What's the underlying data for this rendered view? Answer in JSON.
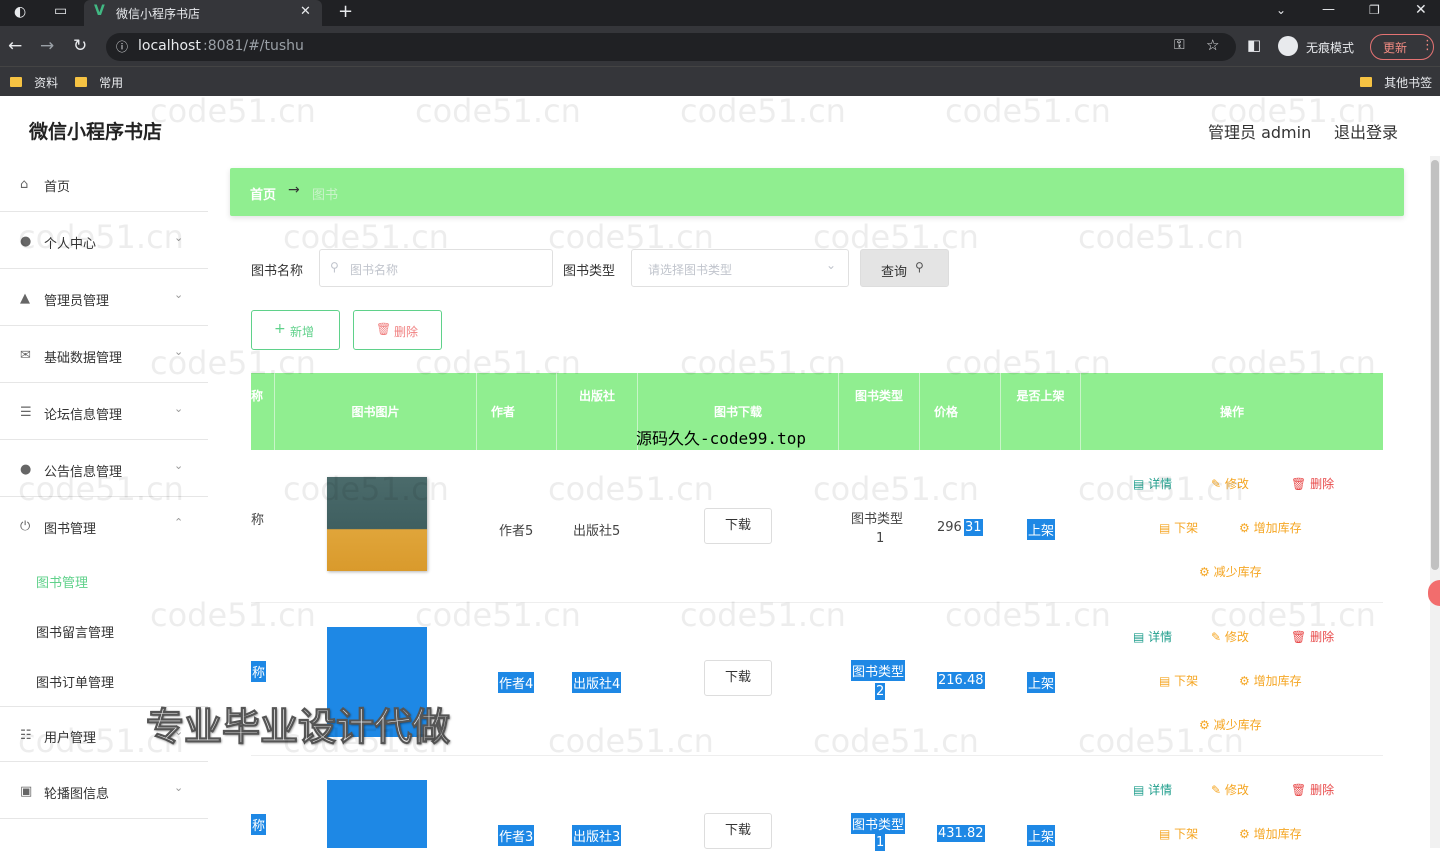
{
  "browser": {
    "tab_title": "微信小程序书店",
    "url_host": "localhost",
    "url_rest": ":8081/#/tushu",
    "incognito_label": "无痕模式",
    "update_label": "更新",
    "bookmarks": [
      "资料",
      "常用"
    ],
    "other_bookmarks": "其他书签"
  },
  "header": {
    "app_title": "微信小程序书店",
    "user_label": "管理员 admin",
    "logout_label": "退出登录"
  },
  "sidebar": {
    "items": [
      {
        "label": "首页",
        "icon": "home-icon"
      },
      {
        "label": "个人中心",
        "icon": "user-icon"
      },
      {
        "label": "管理员管理",
        "icon": "admin-icon"
      },
      {
        "label": "基础数据管理",
        "icon": "mail-icon"
      },
      {
        "label": "论坛信息管理",
        "icon": "list-icon"
      },
      {
        "label": "公告信息管理",
        "icon": "user-icon"
      },
      {
        "label": "图书管理",
        "icon": "power-icon"
      },
      {
        "label": "用户管理",
        "icon": "sliders-icon"
      },
      {
        "label": "轮播图信息",
        "icon": "image-icon"
      }
    ],
    "sub_items": [
      "图书管理",
      "图书留言管理",
      "图书订单管理"
    ]
  },
  "breadcrumb": {
    "home": "首页",
    "sep": "→",
    "current": "图书"
  },
  "search": {
    "name_label": "图书名称",
    "name_placeholder": "图书名称",
    "type_label": "图书类型",
    "type_placeholder": "请选择图书类型",
    "query_label": "查询"
  },
  "actions": {
    "add_label": "新增",
    "delete_label": "删除"
  },
  "table": {
    "headers": [
      "称",
      "图书图片",
      "作者",
      "出版社",
      "图书下载",
      "图书类型",
      "价格",
      "是否上架",
      "操作"
    ],
    "download_label": "下载",
    "op_labels": {
      "detail": "详情",
      "edit": "修改",
      "delete": "删除",
      "off": "下架",
      "add_stock": "增加库存",
      "reduce_stock": "减少库存"
    },
    "rows": [
      {
        "name": "称",
        "author": "作者5",
        "publisher": "出版社5",
        "type_line1": "图书类型",
        "type_line2": "1",
        "price_a": "296",
        "price_b": "31",
        "status": "上架"
      },
      {
        "name": "称",
        "author": "作者4",
        "publisher": "出版社4",
        "type_line1": "图书类型",
        "type_line2": "2",
        "price_a": "",
        "price_b": "216.48",
        "status": "上架"
      },
      {
        "name": "称",
        "author": "作者3",
        "publisher": "出版社3",
        "type_line1": "图书类型",
        "type_line2": "1",
        "price_a": "",
        "price_b": "431.82",
        "status": "上架"
      }
    ]
  },
  "overlays": {
    "site_text": "源码久久-code99.top",
    "promo_text": "专业毕业设计代做",
    "watermark": "code51.cn"
  },
  "colors": {
    "accent_green": "#90ee90",
    "highlight_blue": "#1e88e5"
  }
}
